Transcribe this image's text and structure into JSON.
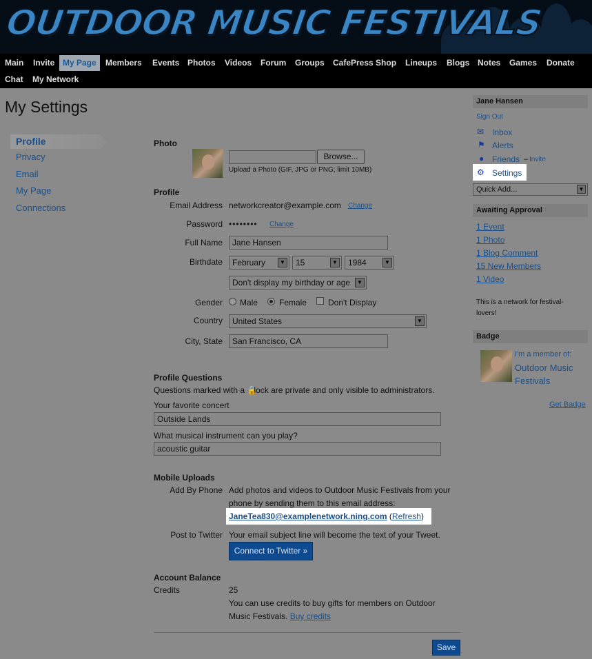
{
  "site": {
    "title": "OUTDOOR MUSIC FESTIVALS"
  },
  "nav": {
    "items": [
      {
        "label": "Main"
      },
      {
        "label": "Invite"
      },
      {
        "label": "My Page"
      },
      {
        "label": "Members"
      },
      {
        "label": "Events"
      },
      {
        "label": "Photos"
      },
      {
        "label": "Videos"
      },
      {
        "label": "Forum"
      },
      {
        "label": "Groups"
      },
      {
        "label": "CafePress Shop"
      },
      {
        "label": "Lineups"
      },
      {
        "label": "Blogs"
      },
      {
        "label": "Notes"
      },
      {
        "label": "Games"
      },
      {
        "label": "Donate"
      },
      {
        "label": "Chat"
      },
      {
        "label": "My Network"
      }
    ],
    "active": "My Page"
  },
  "page": {
    "title": "My Settings"
  },
  "left_nav": {
    "items": [
      {
        "label": "Profile"
      },
      {
        "label": "Privacy"
      },
      {
        "label": "Email"
      },
      {
        "label": "My Page"
      },
      {
        "label": "Connections"
      }
    ],
    "active": "Profile"
  },
  "photo": {
    "heading": "Photo",
    "browse_label": "Browse...",
    "upload_hint": "Upload a Photo (GIF, JPG or PNG; limit 10MB)"
  },
  "profile": {
    "heading": "Profile",
    "email_label": "Email Address",
    "email_value": "networkcreator@example.com",
    "email_change": "Change",
    "password_label": "Password",
    "password_value": "••••••••",
    "password_change": "Change",
    "fullname_label": "Full Name",
    "fullname_value": "Jane Hansen",
    "birthdate_label": "Birthdate",
    "birth_month": "February",
    "birth_day": "15",
    "birth_year": "1984",
    "birth_display": "Don't display my birthday or age",
    "gender_label": "Gender",
    "gender_male": "Male",
    "gender_female": "Female",
    "gender_none": "Don't Display",
    "country_label": "Country",
    "country_value": "United States",
    "city_label": "City, State",
    "city_value": "San Francisco, CA"
  },
  "questions": {
    "heading": "Profile Questions",
    "note_before": "Questions marked with a",
    "note_after": "lock are private and only visible to administrators.",
    "q1_label": "Your favorite concert",
    "q1_value": "Outside Lands",
    "q2_label": "What musical instrument can you play?",
    "q2_value": "acoustic guitar"
  },
  "mobile": {
    "heading": "Mobile Uploads",
    "phone_label": "Add By Phone",
    "phone_line1": "Add photos and videos to Outdoor Music Festivals from your",
    "phone_line2": "phone by sending them to this email address:",
    "upload_email": "JaneTea830@examplenetwork.ning.com",
    "refresh_open": "(",
    "refresh_label": "Refresh",
    "refresh_close": ")",
    "twitter_label": "Post to Twitter",
    "twitter_text": "Your email subject line will become the text of your Tweet.",
    "twitter_button": "Connect to Twitter »"
  },
  "balance": {
    "heading": "Account Balance",
    "credits_label": "Credits",
    "credits_value": "25",
    "info_line1": "You can use credits to buy gifts for members on Outdoor",
    "info_line2": "Music Festivals.",
    "buy_label": "Buy credits"
  },
  "save_label": "Save",
  "sidebar": {
    "user_name": "Jane Hansen",
    "sign_out": "Sign Out",
    "inbox": "Inbox",
    "alerts": "Alerts",
    "friends": "Friends",
    "friends_sep": "–",
    "invite": "Invite",
    "settings": "Settings",
    "quick_add": "Quick Add...",
    "awaiting_heading": "Awaiting Approval",
    "awaiting": [
      {
        "label": "1 Event"
      },
      {
        "label": "1 Photo"
      },
      {
        "label": "1 Blog Comment"
      },
      {
        "label": "15 New Members"
      },
      {
        "label": "1 Video"
      }
    ],
    "about_line1": "This is a network for festival-",
    "about_line2": "lovers!",
    "badge_heading": "Badge",
    "badge_member": "I'm a member of:",
    "badge_network": "Outdoor Music Festivals",
    "get_badge": "Get Badge"
  },
  "colors": {
    "background": "#8a8a8a",
    "link": "#1a4f8a",
    "header": "#000000",
    "title_blue": "#3a86c4",
    "button_blue": "#0d4a8f",
    "highlight": "#ffffff"
  }
}
